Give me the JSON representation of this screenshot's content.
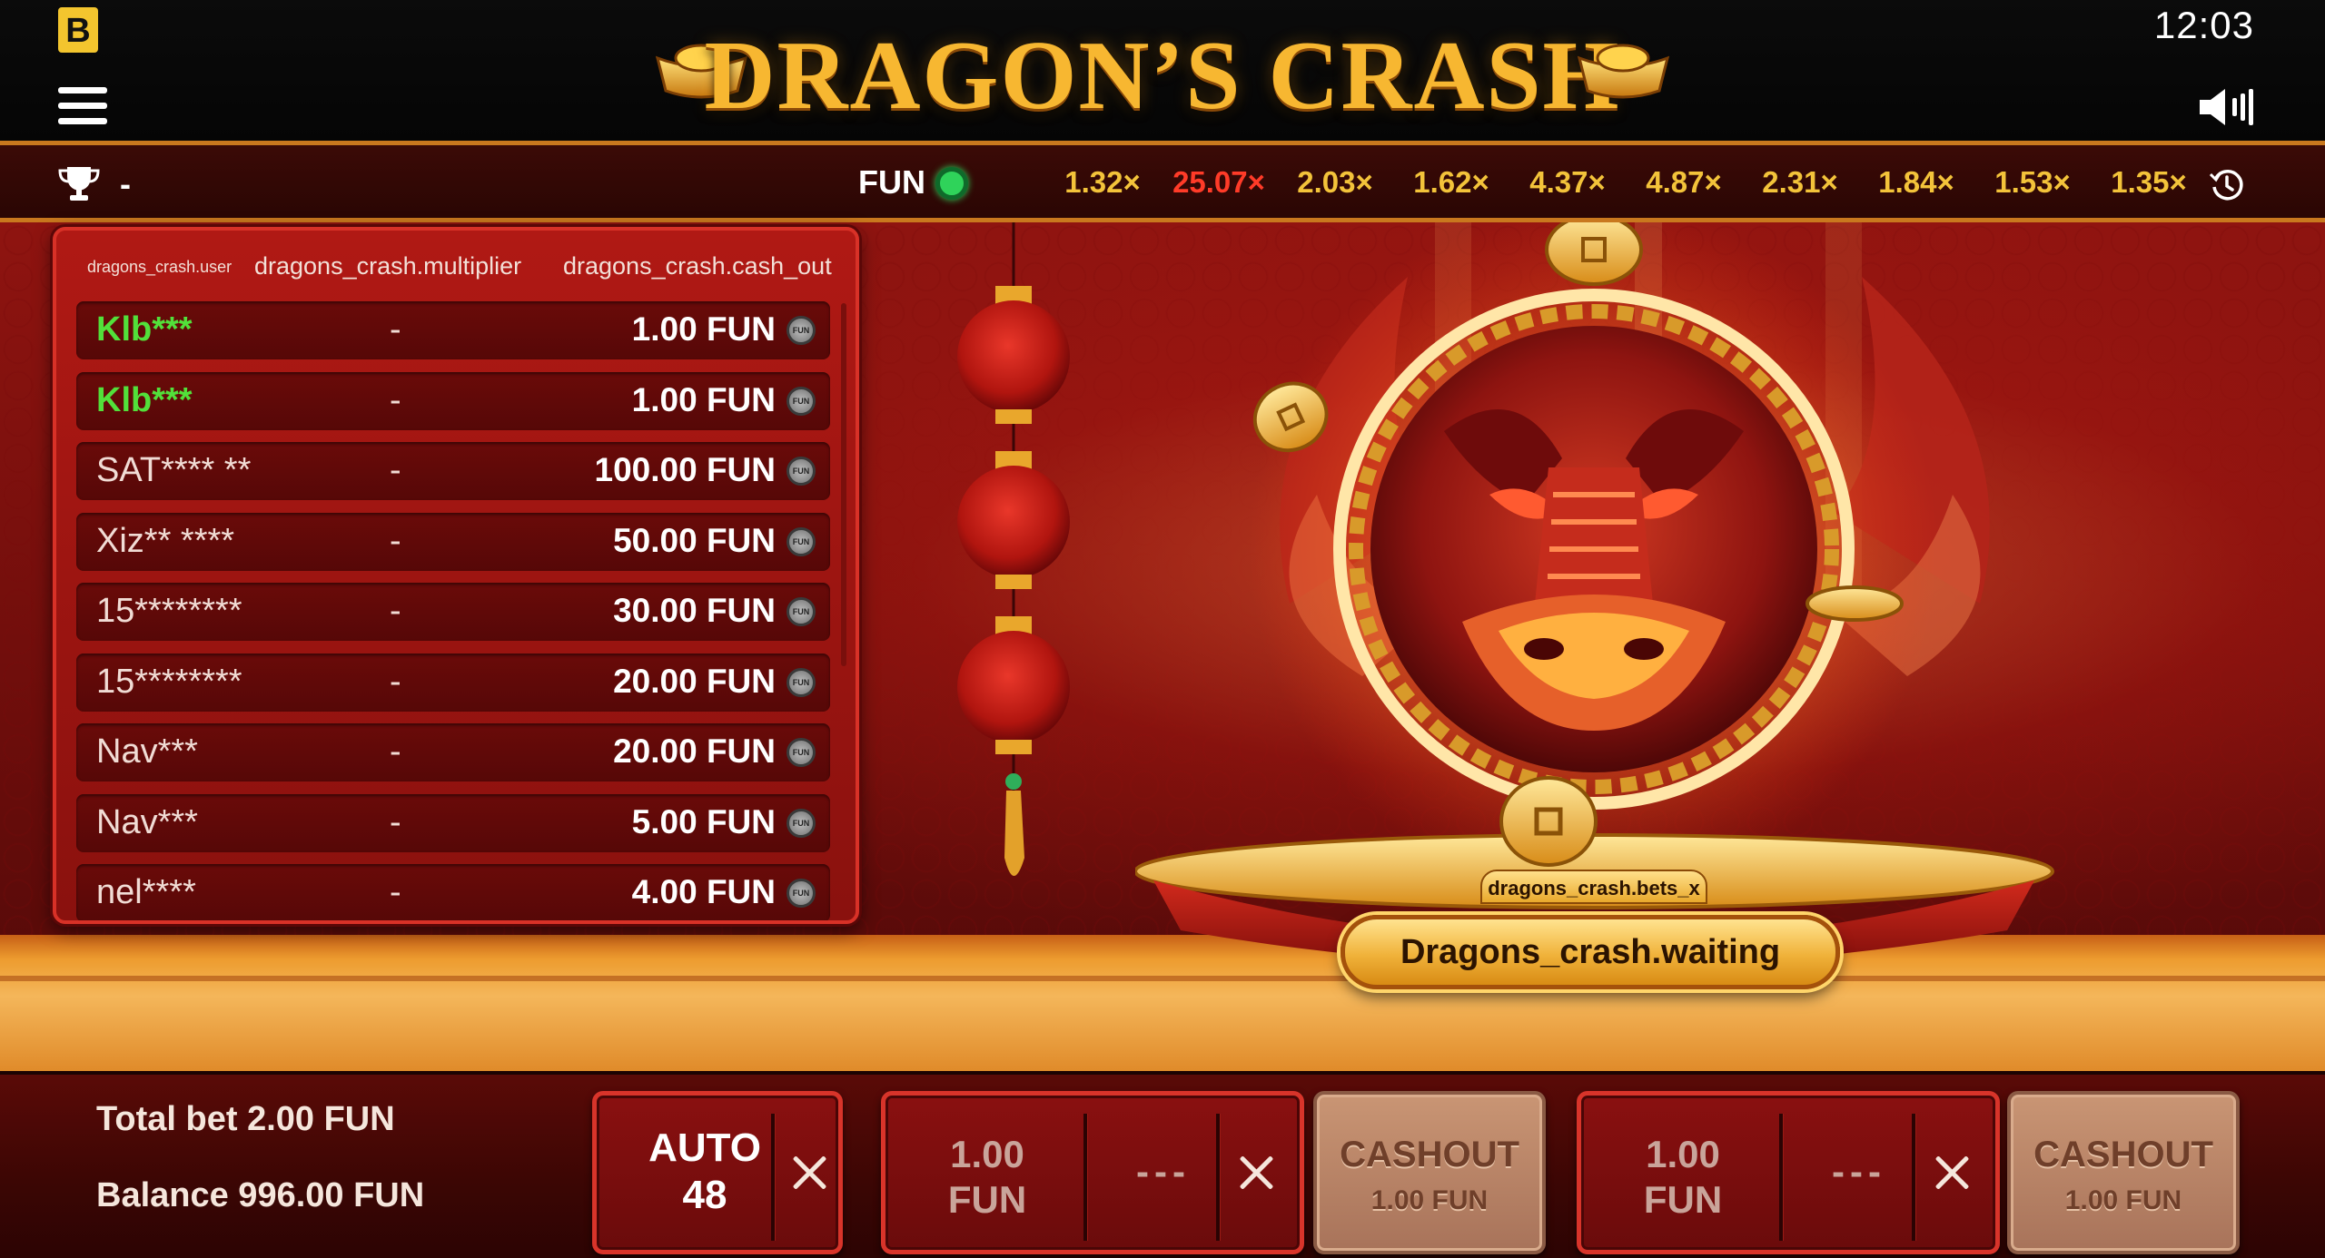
{
  "header": {
    "brand_badge": "B",
    "logo_text": "DRAGON’S CRASH",
    "clock": "12:03",
    "icons": {
      "menu": "hamburger-menu-icon",
      "sound": "speaker-volume-icon"
    }
  },
  "strip": {
    "leader_value": "-",
    "mode_label": "FUN",
    "mode_status_color": "#2fd35a",
    "history": [
      {
        "value": "1.32×",
        "hot": false
      },
      {
        "value": "25.07×",
        "hot": true
      },
      {
        "value": "2.03×",
        "hot": false
      },
      {
        "value": "1.62×",
        "hot": false
      },
      {
        "value": "4.37×",
        "hot": false
      },
      {
        "value": "4.87×",
        "hot": false
      },
      {
        "value": "2.31×",
        "hot": false
      },
      {
        "value": "1.84×",
        "hot": false
      },
      {
        "value": "1.53×",
        "hot": false
      },
      {
        "value": "1.35×",
        "hot": false
      }
    ],
    "icons": {
      "trophy": "trophy-icon",
      "history": "history-clock-icon"
    }
  },
  "bets_panel": {
    "columns": {
      "user": "dragons_crash.user",
      "multiplier": "dragons_crash.multiplier",
      "cash_out": "dragons_crash.cash_out"
    },
    "rows": [
      {
        "user": "Klb***",
        "multiplier": "-",
        "amount": "1.00 FUN",
        "mine": true
      },
      {
        "user": "Klb***",
        "multiplier": "-",
        "amount": "1.00 FUN",
        "mine": true
      },
      {
        "user": "SAT**** **",
        "multiplier": "-",
        "amount": "100.00 FUN",
        "mine": false
      },
      {
        "user": "Xiz** ****",
        "multiplier": "-",
        "amount": "50.00 FUN",
        "mine": false
      },
      {
        "user": "15********",
        "multiplier": "-",
        "amount": "30.00 FUN",
        "mine": false
      },
      {
        "user": "15********",
        "multiplier": "-",
        "amount": "20.00 FUN",
        "mine": false
      },
      {
        "user": "Nav***",
        "multiplier": "-",
        "amount": "20.00 FUN",
        "mine": false
      },
      {
        "user": "Nav***",
        "multiplier": "-",
        "amount": "5.00 FUN",
        "mine": false
      },
      {
        "user": "nel****",
        "multiplier": "-",
        "amount": "4.00 FUN",
        "mine": false
      }
    ],
    "coin_label": "FUN"
  },
  "stage": {
    "bets_x_label": "dragons_crash.bets_x",
    "status": "Dragons_crash.waiting"
  },
  "bottom": {
    "total_bet": "Total bet 2.00 FUN",
    "balance": "Balance 996.00 FUN",
    "auto_line1": "AUTO",
    "auto_line2": "48",
    "bet1": {
      "amount_line1": "1.00",
      "amount_line2": "FUN",
      "multiplier": "---"
    },
    "bet2": {
      "amount_line1": "1.00",
      "amount_line2": "FUN",
      "multiplier": "---"
    },
    "cashout1": {
      "title": "CASHOUT",
      "amount": "1.00 FUN"
    },
    "cashout2": {
      "title": "CASHOUT",
      "amount": "1.00 FUN"
    }
  },
  "colors": {
    "accent_gold": "#f3c33a",
    "hot_result": "#ff3b28",
    "own_user": "#52e03a",
    "panel_red": "#b01914"
  }
}
